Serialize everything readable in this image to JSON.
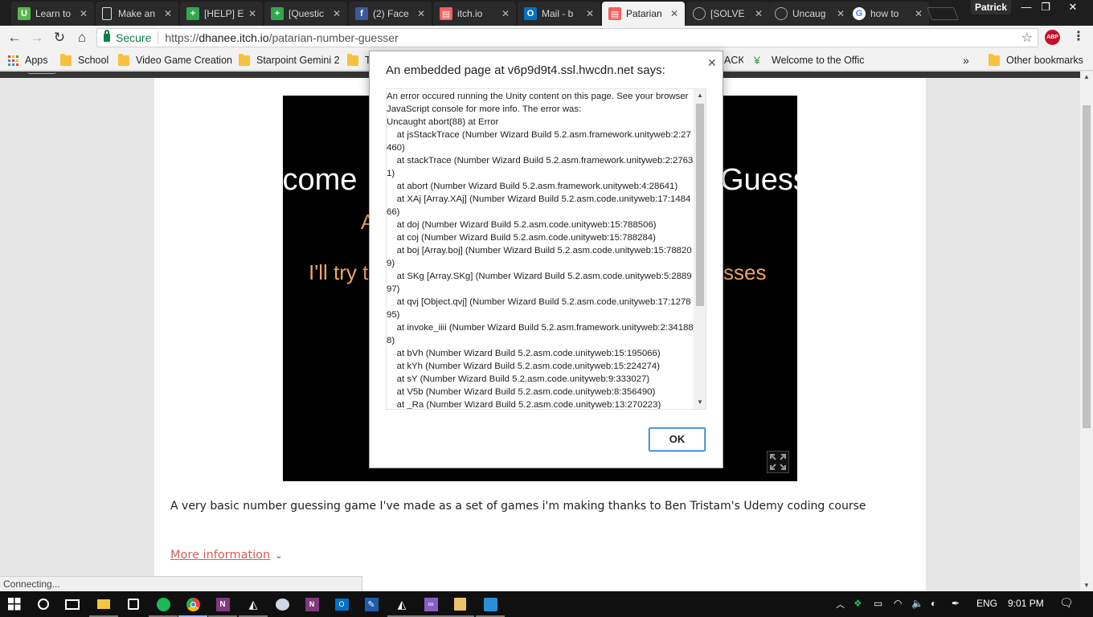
{
  "browser": {
    "profile_name": "Patrick",
    "window_controls": {
      "minimize": "—",
      "maximize": "❐",
      "close": "✕"
    },
    "tabs": [
      {
        "title": "Learn to",
        "favicon": "U",
        "favicon_color": "#55b948",
        "active": false
      },
      {
        "title": "Make an",
        "favicon": "doc",
        "favicon_color": "#2a2a2a",
        "active": false
      },
      {
        "title": "[HELP] E",
        "favicon": "+",
        "favicon_color": "#2fa84f",
        "active": false
      },
      {
        "title": "[Questic",
        "favicon": "+",
        "favicon_color": "#2fa84f",
        "active": false
      },
      {
        "title": "(2) Face",
        "favicon": "f",
        "favicon_color": "#3b5998",
        "active": false
      },
      {
        "title": "itch.io",
        "favicon": "itch",
        "favicon_color": "#fa5c5c",
        "active": false
      },
      {
        "title": "Mail - b",
        "favicon": "O",
        "favicon_color": "#0072c6",
        "active": false
      },
      {
        "title": "Patarian",
        "favicon": "itch",
        "favicon_color": "#fa5c5c",
        "active": true
      },
      {
        "title": "[SOLVE",
        "favicon": "unity",
        "favicon_color": "#444444",
        "active": false
      },
      {
        "title": "Uncaug",
        "favicon": "unity",
        "favicon_color": "#444444",
        "active": false
      },
      {
        "title": "how to",
        "favicon": "G",
        "favicon_color": "#ffffff",
        "active": false
      }
    ],
    "close_icon": "✕",
    "security_label": "Secure",
    "url_scheme": "https://",
    "url_host": "dhanee.itch.io",
    "url_path": "/patarian-number-guesser",
    "adblock_label": "ABP",
    "bookmarks": [
      {
        "label": "Apps",
        "type": "apps"
      },
      {
        "label": "School",
        "type": "folder"
      },
      {
        "label": "Video Game Creation",
        "type": "folder"
      },
      {
        "label": "Starpoint Gemini 2",
        "type": "folder"
      },
      {
        "label": "T",
        "type": "folder"
      },
      {
        "label": "ACK",
        "type": "text"
      },
      {
        "label": "Welcome to the Offic",
        "type": "link"
      }
    ],
    "bookmarks_overflow": "»",
    "other_bookmarks": "Other bookmarks",
    "status_text": "Connecting..."
  },
  "game": {
    "line1_left": "lcome",
    "line1_right": "Guess",
    "line2_left": "A",
    "line3_left": "I'll try t",
    "line3_right": "sses",
    "fullscreen_icon": "fullscreen-icon"
  },
  "page": {
    "description": "A very basic number guessing game I've made as a set of games i'm making thanks to Ben Tristam's Udemy coding course",
    "more_info": "More information",
    "more_info_chevron": "⌄"
  },
  "dialog": {
    "title": "An embedded page at v6p9d9t4.ssl.hwcdn.net says:",
    "close": "✕",
    "message": "An error occured running the Unity content on this page. See your browser JavaScript console for more info. The error was:\nUncaught abort(88) at Error\n    at jsStackTrace (Number Wizard Build 5.2.asm.framework.unityweb:2:27460)\n    at stackTrace (Number Wizard Build 5.2.asm.framework.unityweb:2:27631)\n    at abort (Number Wizard Build 5.2.asm.framework.unityweb:4:28641)\n    at XAj [Array.XAj] (Number Wizard Build 5.2.asm.code.unityweb:17:148466)\n    at doj (Number Wizard Build 5.2.asm.code.unityweb:15:788506)\n    at coj (Number Wizard Build 5.2.asm.code.unityweb:15:788284)\n    at boj [Array.boj] (Number Wizard Build 5.2.asm.code.unityweb:15:788209)\n    at SKg [Array.SKg] (Number Wizard Build 5.2.asm.code.unityweb:5:288997)\n    at qvj [Object.qvj] (Number Wizard Build 5.2.asm.code.unityweb:17:127895)\n    at invoke_iiii (Number Wizard Build 5.2.asm.framework.unityweb:2:341888)\n    at bVh (Number Wizard Build 5.2.asm.code.unityweb:15:195066)\n    at kYh (Number Wizard Build 5.2.asm.code.unityweb:15:224274)\n    at sY (Number Wizard Build 5.2.asm.code.unityweb:9:333027)\n    at V5b (Number Wizard Build 5.2.asm.code.unityweb:8:356490)\n    at _Ra (Number Wizard Build 5.2.asm.code.unityweb:13:270223)",
    "ok_label": "OK"
  },
  "taskbar": {
    "language": "ENG",
    "time": "9:01 PM",
    "apps": [
      "start",
      "cortana",
      "task-view",
      "file-explorer",
      "store",
      "spotify",
      "chrome",
      "onenote",
      "unity",
      "steam",
      "onenote-alt",
      "outlook",
      "sketch",
      "unity-alt",
      "visual-studio",
      "file-manager",
      "app-blue"
    ]
  },
  "colors": {
    "itch_link": "#da5b58",
    "game_text_orange": "#f0a556",
    "secure_green": "#0b8043",
    "ok_border": "#1e74c8"
  }
}
